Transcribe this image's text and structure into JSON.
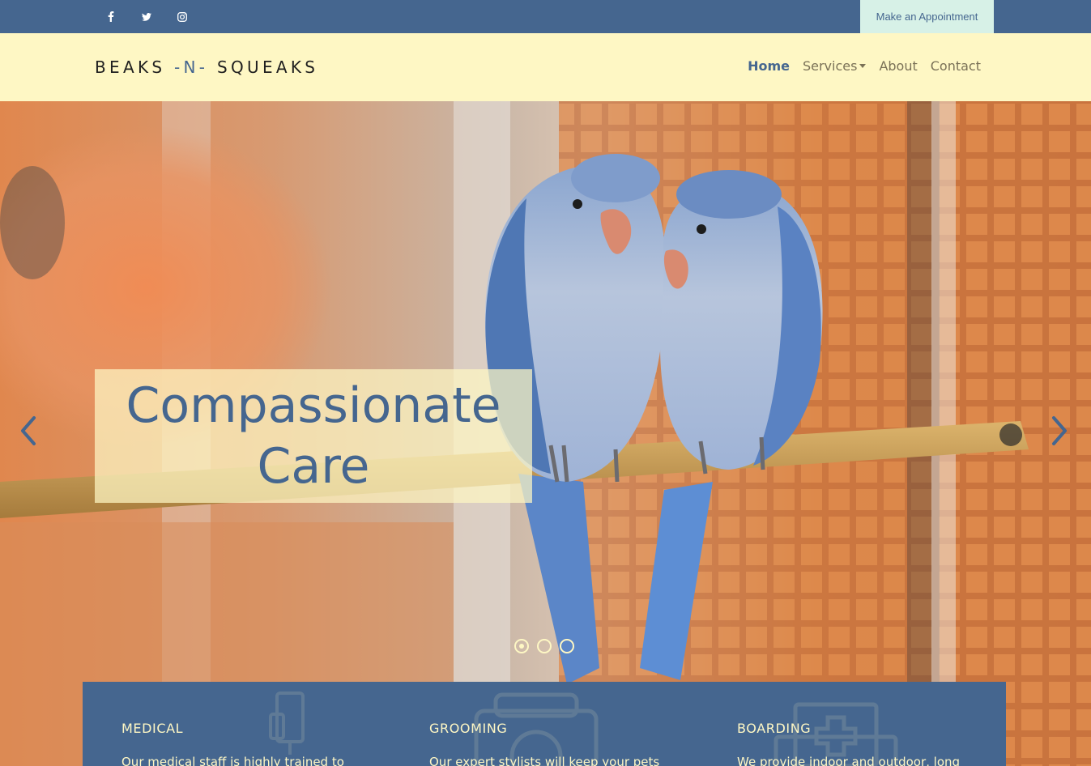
{
  "topbar": {
    "social": [
      {
        "name": "facebook-icon",
        "glyph": "f"
      },
      {
        "name": "twitter-icon",
        "glyph": "twitter"
      },
      {
        "name": "instagram-icon",
        "glyph": "instagram"
      }
    ],
    "appointment_label": "Make an Appointment"
  },
  "navbar": {
    "brand_left": "BEAKS ",
    "brand_accent": "-N-",
    "brand_right": " SQUEAKS",
    "items": [
      {
        "label": "Home",
        "active": true
      },
      {
        "label": "Services",
        "dropdown": true
      },
      {
        "label": "About"
      },
      {
        "label": "Contact"
      }
    ]
  },
  "hero": {
    "caption": "Compassionate Care",
    "prev_icon": "chevron-left-icon",
    "next_icon": "chevron-right-icon",
    "slides": 3,
    "active_slide": 1
  },
  "services": [
    {
      "title": "MEDICAL",
      "desc": "Our medical staff is highly trained to",
      "icon": "iv-drip-icon"
    },
    {
      "title": "GROOMING",
      "desc": "Our expert stylists will keep your pets",
      "icon": "camera-bag-icon"
    },
    {
      "title": "BOARDING",
      "desc": "We provide indoor and outdoor, long",
      "icon": "first-aid-kit-icon"
    }
  ],
  "colors": {
    "primary": "#45668f",
    "cream": "#fef7c4",
    "mint": "#d7f1e7"
  }
}
